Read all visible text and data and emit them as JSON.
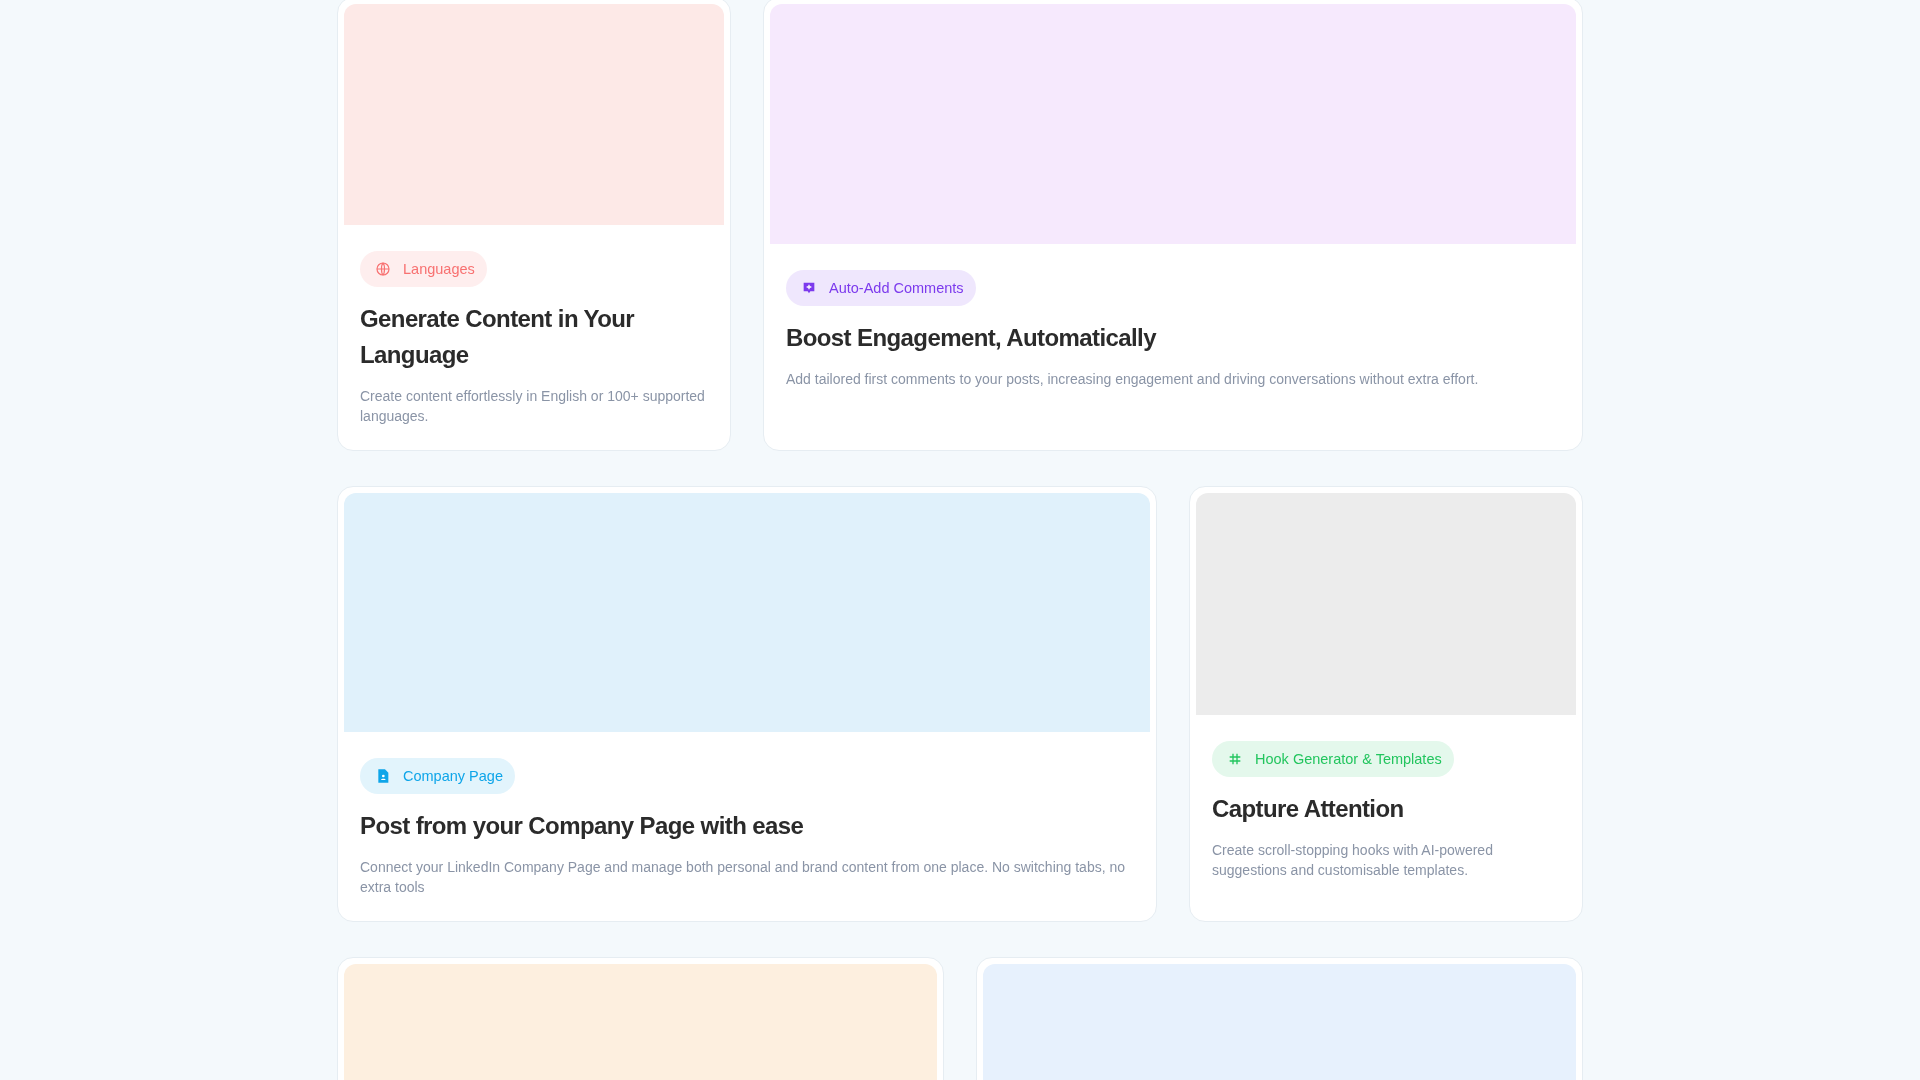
{
  "rows": [
    {
      "cards": [
        {
          "kind": "languages",
          "color": "#f87171",
          "badge": "Languages",
          "title": "Generate Content in Your Language",
          "description": "Create content effortlessly in English or 100+ supported languages."
        },
        {
          "kind": "comments",
          "color": "#7c3aed",
          "badge": "Auto-Add Comments",
          "title": "Boost Engagement, Automatically",
          "description": "Add tailored first comments to your posts, increasing engagement and driving conversations without extra effort."
        }
      ]
    },
    {
      "cards": [
        {
          "kind": "company",
          "color": "#0ea5e9",
          "badge": "Company Page",
          "title": "Post from your Company Page with ease",
          "description": "Connect your LinkedIn Company Page and manage both personal and brand content from one place. No switching tabs, no extra tools"
        },
        {
          "kind": "hooks",
          "color": "#22c55e",
          "badge": "Hook Generator & Templates",
          "title": "Capture Attention",
          "description": "Create scroll-stopping hooks with AI-powered suggestions and customisable templates."
        }
      ]
    },
    {
      "cards": [
        {
          "kind": "peach"
        },
        {
          "kind": "sky"
        }
      ]
    }
  ]
}
